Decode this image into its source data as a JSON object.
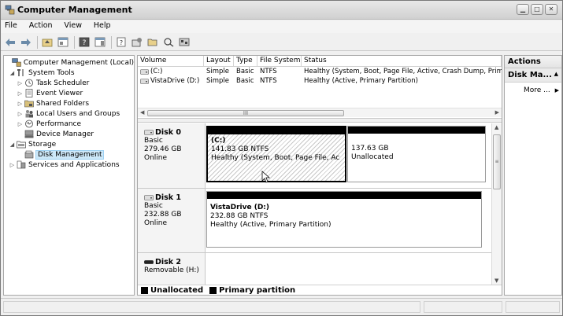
{
  "window": {
    "title": "Computer Management",
    "controls": [
      "minimize-icon",
      "maximize-icon",
      "close-icon"
    ]
  },
  "menu": [
    "File",
    "Action",
    "View",
    "Help"
  ],
  "toolbar": {
    "icons": [
      "back-arrow-icon",
      "forward-arrow-icon",
      "up-folder-icon",
      "show-hide-tree-icon",
      "help-icon",
      "show-hide-action-pane-icon",
      "properties-icon",
      "settings-icon",
      "open-folder-icon",
      "search-icon",
      "disk-properties-icon"
    ]
  },
  "tree": {
    "items": [
      {
        "label": "Computer Management (Local)",
        "level": 0,
        "expander": "",
        "icon": "computer-management-icon"
      },
      {
        "label": "System Tools",
        "level": 1,
        "expander": "◢",
        "icon": "tools-icon"
      },
      {
        "label": "Task Scheduler",
        "level": 2,
        "expander": "▷",
        "icon": "clock-icon"
      },
      {
        "label": "Event Viewer",
        "level": 2,
        "expander": "▷",
        "icon": "event-log-icon"
      },
      {
        "label": "Shared Folders",
        "level": 2,
        "expander": "▷",
        "icon": "shared-folder-icon"
      },
      {
        "label": "Local Users and Groups",
        "level": 2,
        "expander": "▷",
        "icon": "users-icon"
      },
      {
        "label": "Performance",
        "level": 2,
        "expander": "▷",
        "icon": "performance-icon"
      },
      {
        "label": "Device Manager",
        "level": 2,
        "expander": "",
        "icon": "device-manager-icon"
      },
      {
        "label": "Storage",
        "level": 1,
        "expander": "◢",
        "icon": "storage-icon"
      },
      {
        "label": "Disk Management",
        "level": 2,
        "expander": "",
        "icon": "disk-management-icon",
        "selected": true
      },
      {
        "label": "Services and Applications",
        "level": 1,
        "expander": "▷",
        "icon": "services-icon"
      }
    ]
  },
  "volumes": {
    "headers": [
      "Volume",
      "Layout",
      "Type",
      "File System",
      "Status"
    ],
    "rows": [
      [
        "(C:)",
        "Simple",
        "Basic",
        "NTFS",
        "Healthy (System, Boot, Page File, Active, Crash Dump, Prim"
      ],
      [
        "VistaDrive (D:)",
        "Simple",
        "Basic",
        "NTFS",
        "Healthy (Active, Primary Partition)"
      ]
    ],
    "scroll_thumb": "III"
  },
  "disks": [
    {
      "name": "Disk 0",
      "type": "Basic",
      "size": "279.46 GB",
      "state": "Online",
      "partitions": [
        {
          "name": "(C:)",
          "size": "141.83 GB NTFS",
          "status": "Healthy (System, Boot, Page File, Ac"
        },
        {
          "name": "",
          "size": "137.63 GB",
          "status": "Unallocated"
        }
      ]
    },
    {
      "name": "Disk 1",
      "type": "Basic",
      "size": "232.88 GB",
      "state": "Online",
      "partitions": [
        {
          "name": "VistaDrive  (D:)",
          "size": "232.88 GB NTFS",
          "status": "Healthy (Active, Primary Partition)"
        }
      ]
    },
    {
      "name": "Disk 2",
      "type": "Removable (H:)",
      "size": "",
      "state": "",
      "partitions": []
    }
  ],
  "legend": [
    "Unallocated",
    "Primary partition"
  ],
  "vscroll_thumb": "≡",
  "actions": {
    "header": "Actions",
    "section": "Disk Ma...",
    "more": "More ..."
  }
}
